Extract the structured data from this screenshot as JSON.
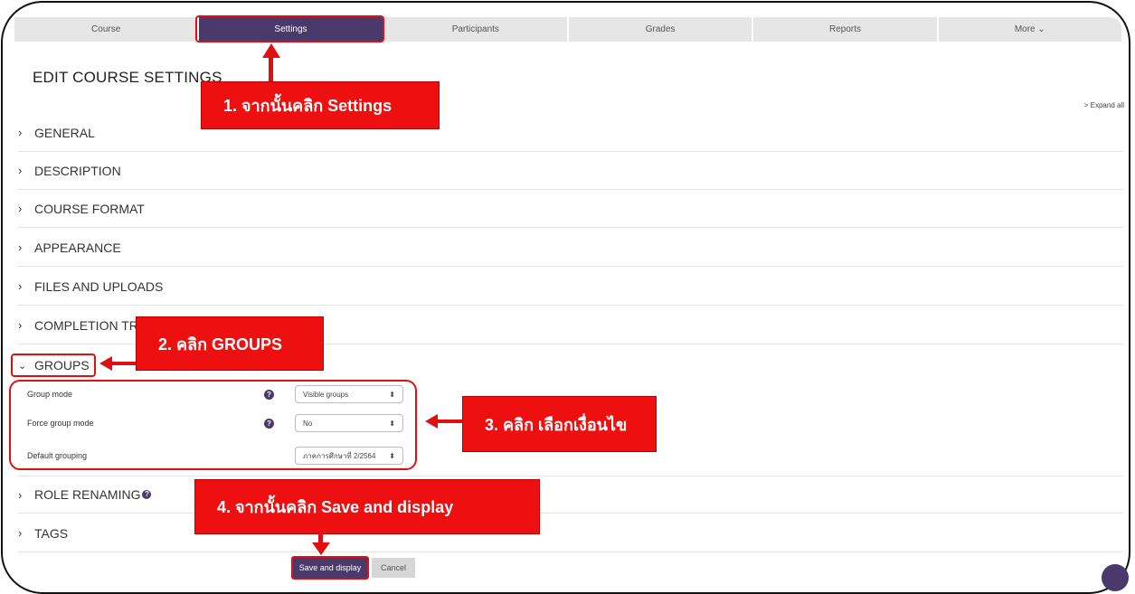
{
  "nav_tabs": [
    "Course",
    "Settings",
    "Participants",
    "Grades",
    "Reports",
    "More ⌄"
  ],
  "page_title": "EDIT COURSE SETTINGS",
  "expand_all": "> Expand all",
  "sections": {
    "general": "GENERAL",
    "description": "DESCRIPTION",
    "course_format": "COURSE FORMAT",
    "appearance": "APPEARANCE",
    "files_and_uploads": "FILES AND UPLOADS",
    "completion_tracking": "COMPLETION TR",
    "groups": "GROUPS",
    "role_renaming": "ROLE RENAMING",
    "tags": "TAGS"
  },
  "groups_form": {
    "group_mode_label": "Group mode",
    "group_mode_value": "Visible groups",
    "force_group_mode_label": "Force group mode",
    "force_group_mode_value": "No",
    "default_grouping_label": "Default grouping",
    "default_grouping_value": "ภาคการศึกษาที่ 2/2564"
  },
  "buttons": {
    "save_and_display": "Save and display",
    "cancel": "Cancel"
  },
  "callouts": {
    "step1": "1. จากนั้นคลิก Settings",
    "step2": "2. คลิก GROUPS",
    "step3": "3. คลิก เลือกเงื่อนไข",
    "step4": "4. จากนั้นคลิก Save and display"
  },
  "colors": {
    "brand": "#4a3a6b",
    "annotation": "#e01010"
  },
  "icons": {
    "chevron_right": "›",
    "chevron_down": "⌄",
    "help": "?",
    "select_arrow": "⬍"
  }
}
